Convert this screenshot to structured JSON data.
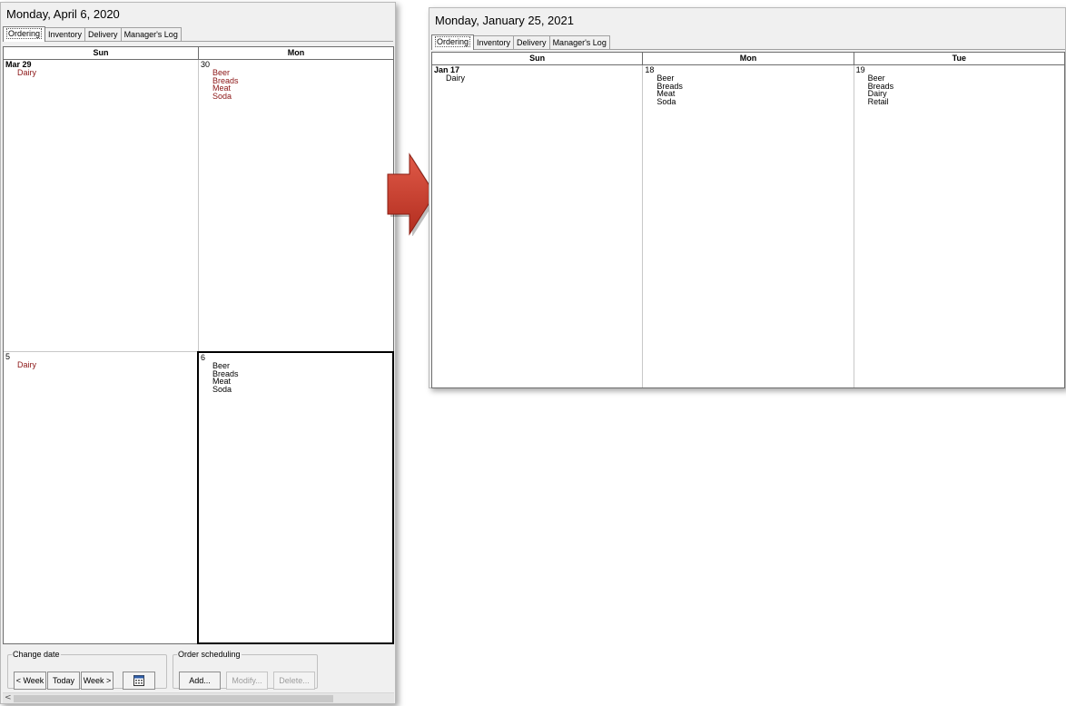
{
  "left_window": {
    "title": "Monday, April 6, 2020",
    "tabs": [
      "Ordering",
      "Inventory",
      "Delivery",
      "Manager's Log"
    ],
    "days": [
      "Sun",
      "Mon"
    ],
    "weeks": [
      {
        "sun": {
          "date": "Mar 29",
          "items": [
            "Dairy"
          ]
        },
        "mon": {
          "date": "30",
          "items": [
            "Beer",
            "Breads",
            "Meat",
            "Soda"
          ]
        }
      },
      {
        "sun": {
          "date": "5",
          "items": [
            "Dairy"
          ]
        },
        "mon": {
          "date": "6",
          "items": [
            "Beer",
            "Breads",
            "Meat",
            "Soda"
          ]
        }
      }
    ],
    "change_date": {
      "legend": "Change date",
      "prev_week": "< Week",
      "today": "Today",
      "next_week": "Week >"
    },
    "order_scheduling": {
      "legend": "Order scheduling",
      "add": "Add...",
      "modify": "Modify...",
      "delete": "Delete..."
    },
    "scroll_left": "<"
  },
  "right_window": {
    "title": "Monday, January 25, 2021",
    "tabs": [
      "Ordering",
      "Inventory",
      "Delivery",
      "Manager's Log"
    ],
    "days": [
      "Sun",
      "Mon",
      "Tue"
    ],
    "week": {
      "sun": {
        "date": "Jan 17",
        "items": [
          "Dairy"
        ]
      },
      "mon": {
        "date": "18",
        "items": [
          "Beer",
          "Breads",
          "Meat",
          "Soda"
        ]
      },
      "tue": {
        "date": "19",
        "items": [
          "Beer",
          "Breads",
          "Dairy",
          "Retail"
        ]
      }
    }
  },
  "icons": {
    "calendar": "calendar-icon",
    "arrow": "right-arrow-icon"
  },
  "colors": {
    "item_red": "#8b1414",
    "arrow_red": "#c9392a"
  }
}
